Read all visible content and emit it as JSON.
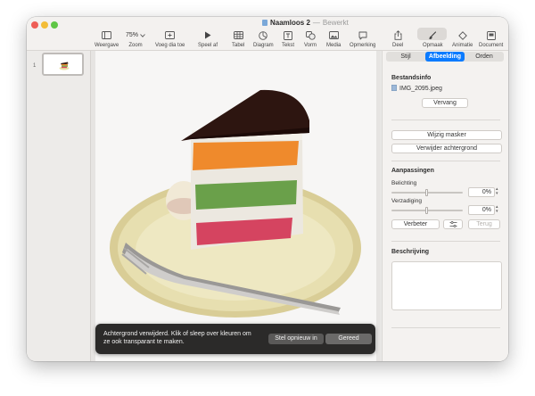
{
  "window": {
    "title": "Naamloos 2",
    "separator": "—",
    "status": "Bewerkt"
  },
  "toolbar": {
    "items": [
      {
        "label": "Weergave",
        "icon": "sidebar-view-icon"
      },
      {
        "label": "Zoom",
        "value": "75%",
        "icon": "chevron-down-icon"
      },
      {
        "label": "Voeg dia toe",
        "icon": "add-slide-icon"
      },
      {
        "label": "Speel af",
        "icon": "play-icon"
      },
      {
        "label": "Tabel",
        "icon": "table-icon"
      },
      {
        "label": "Diagram",
        "icon": "chart-icon"
      },
      {
        "label": "Tekst",
        "icon": "text-icon"
      },
      {
        "label": "Vorm",
        "icon": "shape-icon"
      },
      {
        "label": "Media",
        "icon": "media-icon"
      },
      {
        "label": "Opmerking",
        "icon": "comment-icon"
      },
      {
        "label": "Deel",
        "icon": "share-icon"
      },
      {
        "label": "Opmaak",
        "icon": "format-brush-icon"
      },
      {
        "label": "Animatie",
        "icon": "animate-icon"
      },
      {
        "label": "Document",
        "icon": "document-icon"
      }
    ]
  },
  "slide_navigator": {
    "slides": [
      {
        "number": "1"
      }
    ]
  },
  "notice": {
    "message": "Achtergrond verwijderd. Klik of sleep over kleuren om ze ook transparant te maken.",
    "reset_label": "Stel opnieuw in",
    "done_label": "Gereed"
  },
  "inspector": {
    "tabs": [
      {
        "label": "Stijl",
        "active": false
      },
      {
        "label": "Afbeelding",
        "active": true
      },
      {
        "label": "Orden",
        "active": false
      }
    ],
    "file_info": {
      "heading": "Bestandsinfo",
      "filename": "IMG_2095.jpeg",
      "replace_label": "Vervang"
    },
    "mask_label": "Wijzig masker",
    "remove_bg_label": "Verwijder achtergrond",
    "adjustments": {
      "heading": "Aanpassingen",
      "exposure_label": "Belichting",
      "exposure_value": "0%",
      "exposure_level": 0.5,
      "saturation_label": "Verzadiging",
      "saturation_value": "0%",
      "saturation_level": 0.5,
      "enhance_label": "Verbeter",
      "reset_label": "Terug"
    },
    "description": {
      "heading": "Beschrijving",
      "text": ""
    }
  },
  "colors": {
    "accent": "#0b7bff"
  }
}
